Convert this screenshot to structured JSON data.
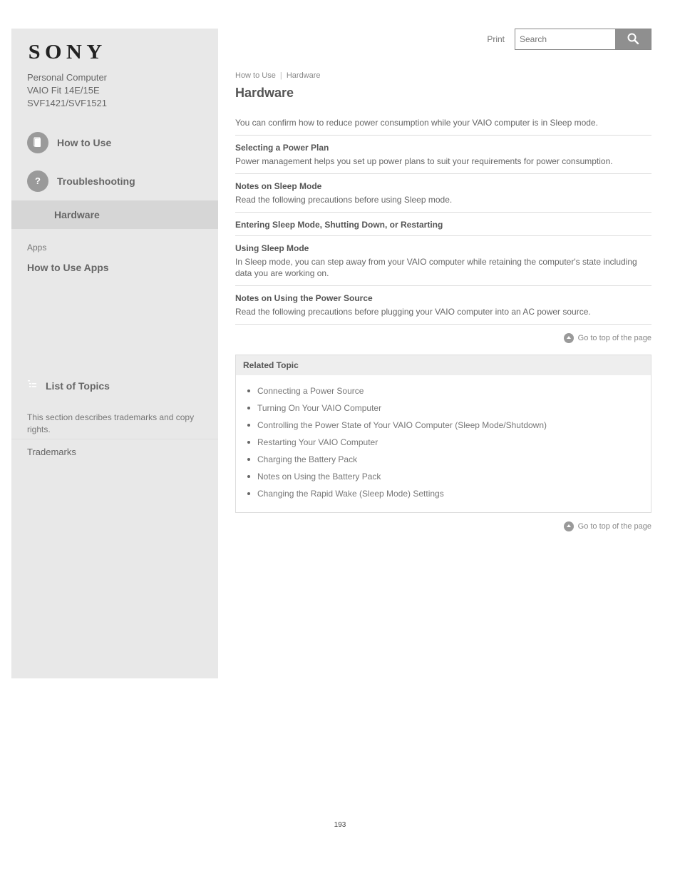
{
  "brand": "SONY",
  "product": {
    "category": "Personal Computer",
    "series": "VAIO Fit 14E/15E",
    "model": "SVF1421/SVF1521"
  },
  "sidebar": {
    "how_to_use": "How to Use",
    "troubleshooting": "Troubleshooting",
    "hardware": "Hardware",
    "apps_intro": "Apps",
    "apps_title": "How to Use Apps",
    "list_of_topics": "List of Topics",
    "trademarks_notice": "This section describes trademarks and copy rights.",
    "trademarks": "Trademarks"
  },
  "top": {
    "print": "Print",
    "search_placeholder": "Search"
  },
  "breadcrumb": {
    "a": "How to Use",
    "b": "Hardware"
  },
  "page_title": "Hardware",
  "intro": "You can confirm how to reduce power consumption while your VAIO computer is in Sleep mode.",
  "sections": [
    {
      "title": "Selecting a Power Plan",
      "desc": "Power management helps you set up power plans to suit your requirements for power consumption."
    },
    {
      "title": "Notes on Sleep Mode",
      "desc": "Read the following precautions before using Sleep mode."
    },
    {
      "title": "Entering Sleep Mode, Shutting Down, or Restarting",
      "desc": ""
    },
    {
      "title": "Using Sleep Mode",
      "desc": "In Sleep mode, you can step away from your VAIO computer while retaining the computer's state including data you are working on."
    },
    {
      "title": "Notes on Using the Power Source",
      "desc": "Read the following precautions before plugging your VAIO computer into an AC power source."
    }
  ],
  "go_to_top": "Go to top of the page",
  "related": {
    "heading": "Related Topic",
    "items": [
      "Connecting a Power Source",
      "Turning On Your VAIO Computer",
      "Controlling the Power State of Your VAIO Computer (Sleep Mode/Shutdown)",
      "Restarting Your VAIO Computer",
      "Charging the Battery Pack",
      "Notes on Using the Battery Pack",
      "Changing the Rapid Wake (Sleep Mode) Settings"
    ]
  },
  "page_number": "193"
}
